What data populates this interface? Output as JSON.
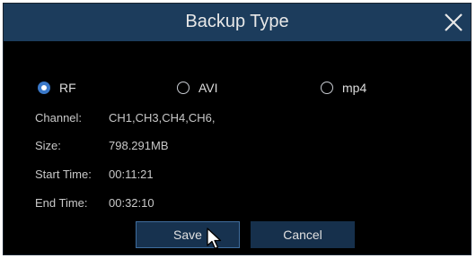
{
  "dialog": {
    "title": "Backup Type"
  },
  "options": [
    {
      "label": "RF",
      "checked": true
    },
    {
      "label": "AVI",
      "checked": false
    },
    {
      "label": "mp4",
      "checked": false
    }
  ],
  "details": {
    "channel_label": "Channel:",
    "channel_value": "CH1,CH3,CH4,CH6,",
    "size_label": "Size:",
    "size_value": "798.291MB",
    "start_label": "Start Time:",
    "start_value": "00:11:21",
    "end_label": "End Time:",
    "end_value": "00:32:10"
  },
  "buttons": {
    "save_label": "Save",
    "cancel_label": "Cancel"
  },
  "colors": {
    "titlebar": "#1c3c5c",
    "accent": "#3a78c8",
    "button": "#17324f"
  }
}
